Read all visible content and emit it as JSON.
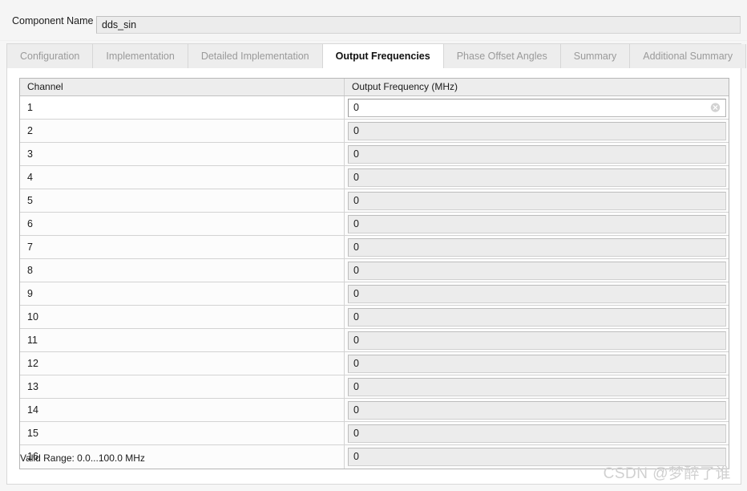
{
  "component": {
    "label": "Component Name",
    "value": "dds_sin"
  },
  "tabs": [
    {
      "label": "Configuration",
      "active": false
    },
    {
      "label": "Implementation",
      "active": false
    },
    {
      "label": "Detailed Implementation",
      "active": false
    },
    {
      "label": "Output Frequencies",
      "active": true
    },
    {
      "label": "Phase Offset Angles",
      "active": false
    },
    {
      "label": "Summary",
      "active": false
    },
    {
      "label": "Additional Summary",
      "active": false
    }
  ],
  "table": {
    "columns": [
      "Channel",
      "Output Frequency (MHz)"
    ],
    "rows": [
      {
        "channel": "1",
        "frequency": "0",
        "focused": true,
        "clear_icon": "clear-circle-icon"
      },
      {
        "channel": "2",
        "frequency": "0",
        "focused": false
      },
      {
        "channel": "3",
        "frequency": "0",
        "focused": false
      },
      {
        "channel": "4",
        "frequency": "0",
        "focused": false
      },
      {
        "channel": "5",
        "frequency": "0",
        "focused": false
      },
      {
        "channel": "6",
        "frequency": "0",
        "focused": false
      },
      {
        "channel": "7",
        "frequency": "0",
        "focused": false
      },
      {
        "channel": "8",
        "frequency": "0",
        "focused": false
      },
      {
        "channel": "9",
        "frequency": "0",
        "focused": false
      },
      {
        "channel": "10",
        "frequency": "0",
        "focused": false
      },
      {
        "channel": "11",
        "frequency": "0",
        "focused": false
      },
      {
        "channel": "12",
        "frequency": "0",
        "focused": false
      },
      {
        "channel": "13",
        "frequency": "0",
        "focused": false
      },
      {
        "channel": "14",
        "frequency": "0",
        "focused": false
      },
      {
        "channel": "15",
        "frequency": "0",
        "focused": false
      },
      {
        "channel": "16",
        "frequency": "0",
        "focused": false
      }
    ]
  },
  "footer": {
    "valid_range": "Valid Range: 0.0...100.0 MHz"
  },
  "watermark": {
    "text": "CSDN @梦醉了谁"
  },
  "colors": {
    "panel_bg": "#ffffff",
    "window_bg": "#f6f6f6",
    "tab_bg": "#ededed",
    "tab_active_bg": "#ffffff",
    "tab_text": "#9a9a9a",
    "tab_active_text": "#111111",
    "border": "#d8d8d8",
    "table_border": "#b6b6b6",
    "input_bg": "#ececec",
    "watermark": "#d0d0d0"
  }
}
